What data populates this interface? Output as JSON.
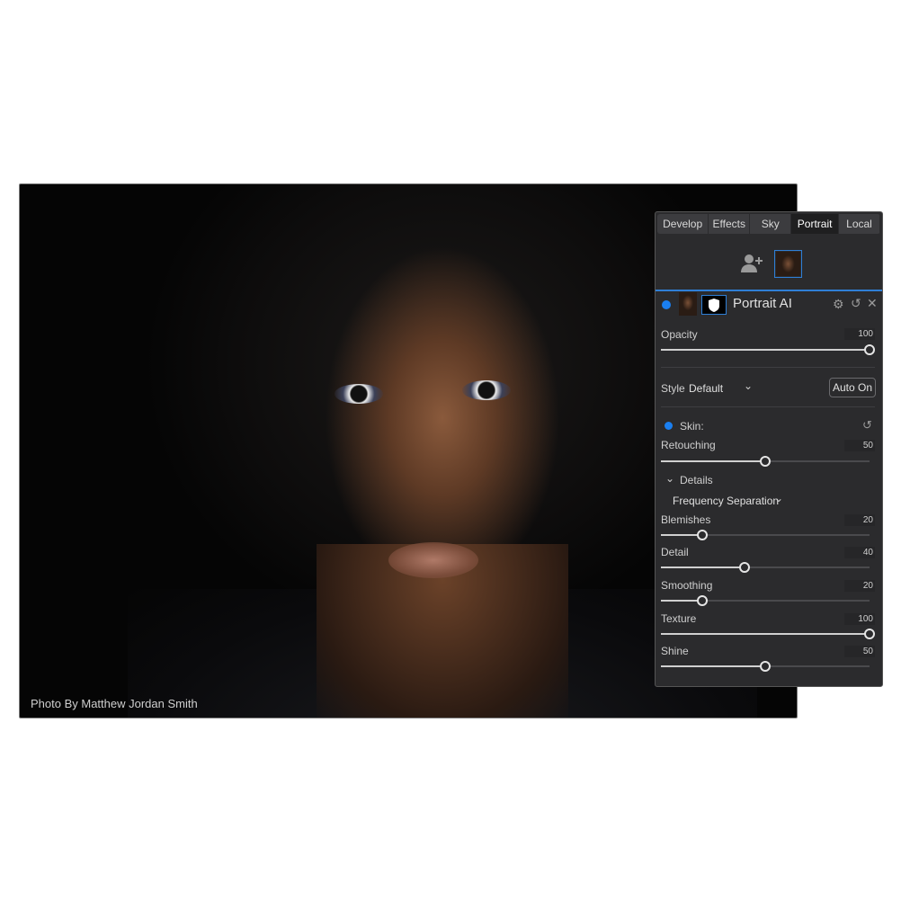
{
  "photo": {
    "credit": "Photo By Matthew Jordan Smith"
  },
  "panel": {
    "tabs": [
      {
        "label": "Develop"
      },
      {
        "label": "Effects"
      },
      {
        "label": "Sky"
      },
      {
        "label": "Portrait",
        "active": true
      },
      {
        "label": "Local"
      }
    ],
    "filter_title": "Portrait AI",
    "opacity": {
      "label": "Opacity",
      "value": 100
    },
    "style": {
      "label": "Style",
      "value": "Default",
      "auto_button": "Auto On"
    },
    "skin": {
      "label": "Skin:"
    },
    "retouching": {
      "label": "Retouching",
      "value": 50
    },
    "details": {
      "label": "Details",
      "mode": "Frequency Separation"
    },
    "sliders": [
      {
        "label": "Blemishes",
        "value": 20
      },
      {
        "label": "Detail",
        "value": 40
      },
      {
        "label": "Smoothing",
        "value": 20
      },
      {
        "label": "Texture",
        "value": 100
      },
      {
        "label": "Shine",
        "value": 50
      }
    ],
    "accent": "#1a7ff0"
  }
}
